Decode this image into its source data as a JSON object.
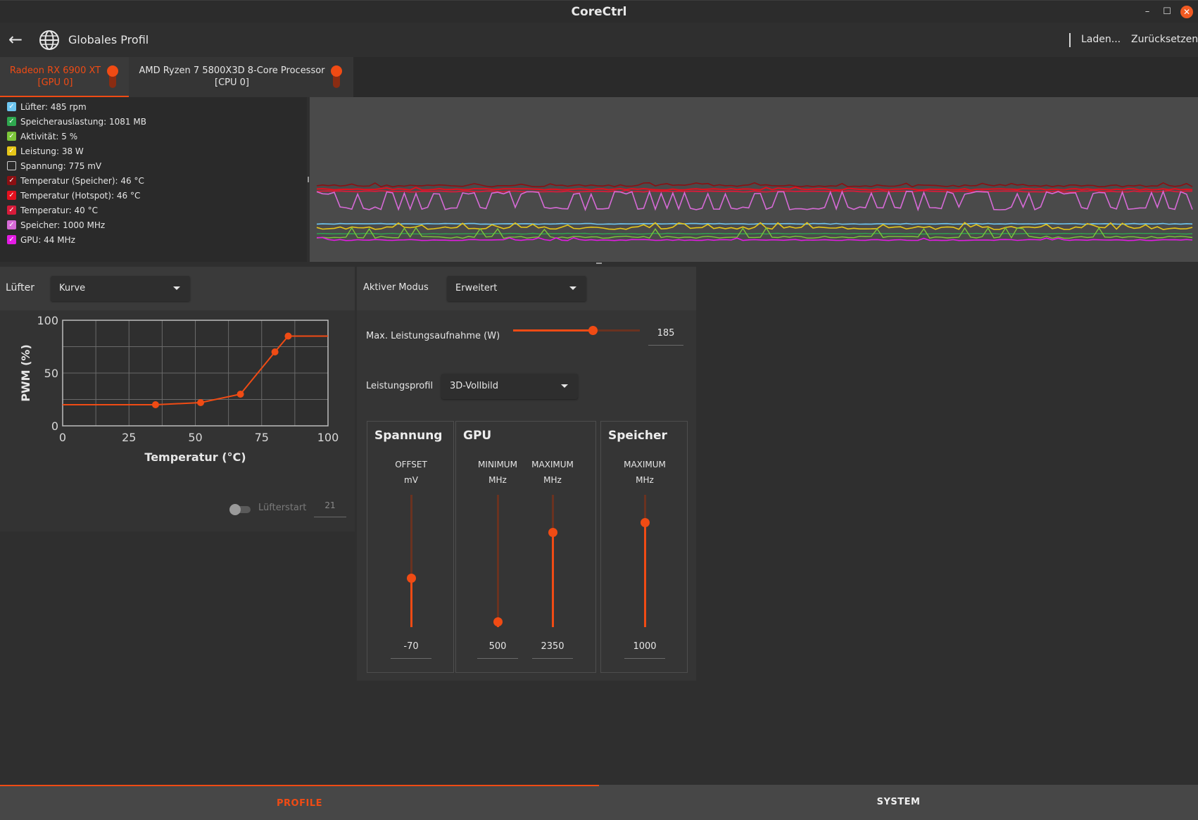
{
  "window": {
    "title": "CoreCtrl"
  },
  "header": {
    "profile_name": "Globales Profil",
    "load_label": "Laden...",
    "reset_label": "Zurücksetzen"
  },
  "device_tabs": [
    {
      "name": "Radeon RX 6900 XT",
      "id": "[GPU 0]",
      "active": true
    },
    {
      "name": "AMD Ryzen 7 5800X3D 8-Core Processor",
      "id": "[CPU 0]",
      "active": false
    }
  ],
  "sensors": [
    {
      "label": "Lüfter: 485 rpm",
      "color": "#6ec6f0",
      "checked": true
    },
    {
      "label": "Speicherauslastung: 1081 MB",
      "color": "#2fa84f",
      "checked": true
    },
    {
      "label": "Aktivität: 5 %",
      "color": "#7cc63a",
      "checked": true
    },
    {
      "label": "Leistung: 38 W",
      "color": "#e6c619",
      "checked": true
    },
    {
      "label": "Spannung: 775 mV",
      "color": "#cfcfcf",
      "checked": false
    },
    {
      "label": "Temperatur (Speicher): 46 °C",
      "color": "#8b0f12",
      "checked": true
    },
    {
      "label": "Temperatur (Hotspot): 46 °C",
      "color": "#e4101e",
      "checked": true
    },
    {
      "label": "Temperatur: 40 °C",
      "color": "#d81b3a",
      "checked": true
    },
    {
      "label": "Speicher: 1000 MHz",
      "color": "#d66ad6",
      "checked": true
    },
    {
      "label": "GPU: 44 MHz",
      "color": "#e41ce4",
      "checked": true
    }
  ],
  "fan": {
    "label": "Lüfter",
    "mode": "Kurve",
    "fan_start_label": "Lüfterstart",
    "fan_start_value": "21"
  },
  "chart_data": {
    "type": "line",
    "xlabel": "Temperatur (°C)",
    "ylabel": "PWM (%)",
    "xlim": [
      0,
      100
    ],
    "ylim": [
      0,
      100
    ],
    "x_ticks": [
      "0",
      "25",
      "50",
      "75",
      "100"
    ],
    "y_ticks": [
      "0",
      "50",
      "100"
    ],
    "grid": true,
    "series": [
      {
        "points": [
          [
            35,
            20
          ],
          [
            52,
            22
          ],
          [
            67,
            30
          ],
          [
            80,
            70
          ],
          [
            85,
            85
          ]
        ],
        "start_y": 20,
        "end_y": 85
      }
    ],
    "accent": "#f04b14"
  },
  "power": {
    "mode_label": "Aktiver Modus",
    "mode_value": "Erweitert",
    "max_power_label": "Max. Leistungsaufnahme (W)",
    "max_power_value": "185",
    "max_power_fraction": 0.63,
    "profile_label": "Leistungsprofil",
    "profile_value": "3D-Vollbild"
  },
  "groups": {
    "voltage": {
      "title": "Spannung",
      "cols": [
        {
          "name": "OFFSET",
          "unit": "mV",
          "value": "-70",
          "fraction": 0.37
        }
      ]
    },
    "gpu": {
      "title": "GPU",
      "cols": [
        {
          "name": "MINIMUM",
          "unit": "MHz",
          "value": "500",
          "fraction": 0.04
        },
        {
          "name": "MAXIMUM",
          "unit": "MHz",
          "value": "2350",
          "fraction": 0.72
        }
      ]
    },
    "memory": {
      "title": "Speicher",
      "cols": [
        {
          "name": "MAXIMUM",
          "unit": "MHz",
          "value": "1000",
          "fraction": 0.79
        }
      ]
    }
  },
  "bottom_tabs": {
    "profile": "PROFILE",
    "system": "SYSTEM"
  }
}
